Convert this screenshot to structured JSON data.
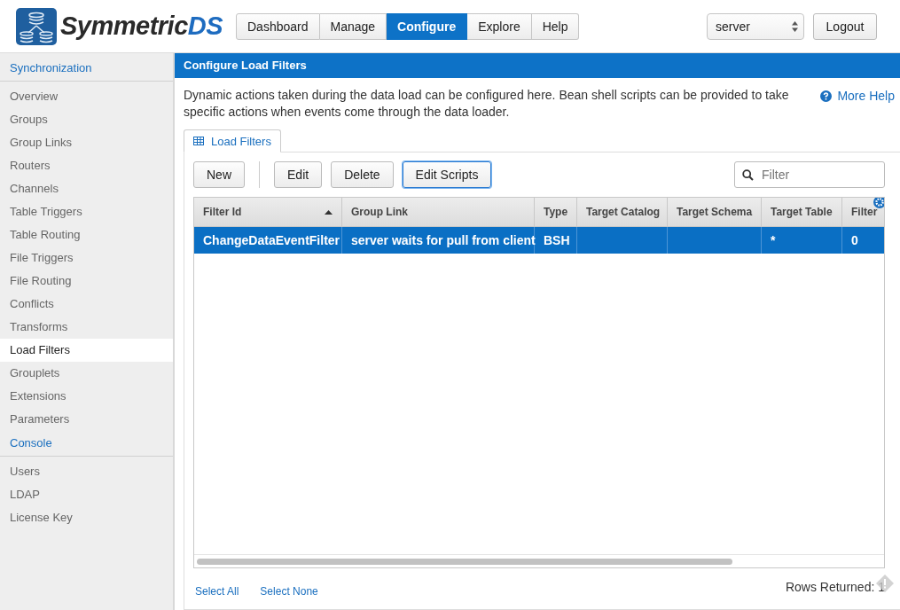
{
  "header": {
    "logo": {
      "name_main": "Symmetric",
      "name_accent": "DS"
    },
    "nav": [
      {
        "label": "Dashboard",
        "selected": false
      },
      {
        "label": "Manage",
        "selected": false
      },
      {
        "label": "Configure",
        "selected": true
      },
      {
        "label": "Explore",
        "selected": false
      },
      {
        "label": "Help",
        "selected": false
      }
    ],
    "node_select": {
      "value": "server"
    },
    "logout": "Logout"
  },
  "sidebar": {
    "sections": [
      {
        "title": "Synchronization",
        "items": [
          {
            "label": "Overview",
            "selected": false
          },
          {
            "label": "Groups",
            "selected": false
          },
          {
            "label": "Group Links",
            "selected": false
          },
          {
            "label": "Routers",
            "selected": false
          },
          {
            "label": "Channels",
            "selected": false
          },
          {
            "label": "Table Triggers",
            "selected": false
          },
          {
            "label": "Table Routing",
            "selected": false
          },
          {
            "label": "File Triggers",
            "selected": false
          },
          {
            "label": "File Routing",
            "selected": false
          },
          {
            "label": "Conflicts",
            "selected": false
          },
          {
            "label": "Transforms",
            "selected": false
          },
          {
            "label": "Load Filters",
            "selected": true
          },
          {
            "label": "Grouplets",
            "selected": false
          },
          {
            "label": "Extensions",
            "selected": false
          },
          {
            "label": "Parameters",
            "selected": false
          }
        ]
      },
      {
        "title": "Console",
        "items": [
          {
            "label": "Users",
            "selected": false
          },
          {
            "label": "LDAP",
            "selected": false
          },
          {
            "label": "License Key",
            "selected": false
          }
        ]
      }
    ]
  },
  "page": {
    "title": "Configure Load Filters",
    "description": "Dynamic actions taken during the data load can be configured here. Bean shell scripts can be provided to take specific actions when events come through the data loader.",
    "help_link": "More Help",
    "tabs": [
      {
        "label": "Load Filters",
        "selected": true
      }
    ],
    "toolbar": {
      "buttons": [
        {
          "label": "New",
          "focused": false
        },
        {
          "label": "Edit",
          "focused": false
        },
        {
          "label": "Delete",
          "focused": false
        },
        {
          "label": "Edit Scripts",
          "focused": true
        }
      ],
      "filter": {
        "placeholder": "Filter"
      }
    },
    "table": {
      "columns": [
        {
          "label": "Filter Id",
          "sorted": true
        },
        {
          "label": "Group Link",
          "sorted": false
        },
        {
          "label": "Type",
          "sorted": false
        },
        {
          "label": "Target Catalog",
          "sorted": false
        },
        {
          "label": "Target Schema",
          "sorted": false
        },
        {
          "label": "Target Table",
          "sorted": false
        },
        {
          "label": "Filter",
          "sorted": false
        }
      ],
      "rows": [
        {
          "selected": true,
          "cells": [
            "ChangeDataEventFilter",
            "server waits for pull from client",
            "BSH",
            "",
            "",
            "*",
            "0"
          ]
        }
      ]
    },
    "footer": {
      "links": [
        "Select All",
        "Select None"
      ],
      "rows_returned": "Rows Returned: 1"
    }
  }
}
